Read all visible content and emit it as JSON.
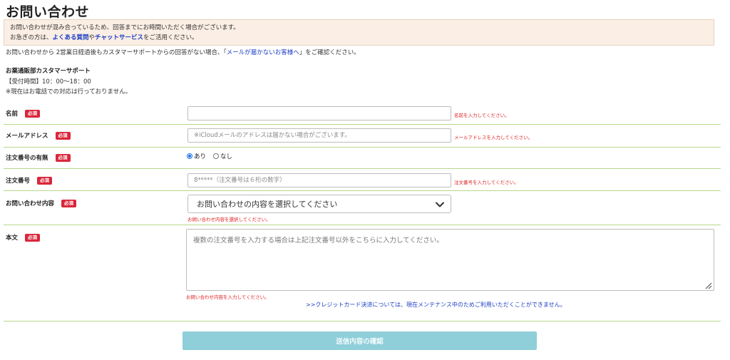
{
  "page": {
    "title": "お問い合わせ"
  },
  "notice": {
    "line1": "お問い合わせが混み合っているため、回答までにお時間いただく場合がございます。",
    "line2_prefix": "お急ぎの方は、",
    "faq_link": "よくある質問",
    "line2_mid": "や",
    "chat_link": "チャットサービス",
    "line2_suffix": "をご活用ください。"
  },
  "sub_note": {
    "prefix": "お問い合わせから 2営業日経過後もカスタマーサポートからの回答がない場合、「",
    "link": "メールが届かないお客様へ",
    "suffix": "」をご確認ください。"
  },
  "support": {
    "name": "お薬通販部カスタマーサポート",
    "hours": "【受付時間】10：00〜18：00",
    "phone_note": "※現在はお電話での対応は行っておりません。"
  },
  "required_badge": "必須",
  "form": {
    "name": {
      "label": "名前",
      "value": "",
      "placeholder": "",
      "error": "名前を入力してください。"
    },
    "email": {
      "label": "メールアドレス",
      "value": "",
      "placeholder": "※iCloudメールのアドレスは届かない場合がございます。",
      "error": "メールアドレスを入力してください。"
    },
    "order_presence": {
      "label": "注文番号の有無",
      "options": [
        "あり",
        "なし"
      ],
      "selected": "あり"
    },
    "order_number": {
      "label": "注文番号",
      "value": "",
      "placeholder": "8*****（注文番号は６桁の数字）",
      "error": "注文番号を入力してください。"
    },
    "inquiry_type": {
      "label": "お問い合わせ内容",
      "selected": "お問い合わせの内容を選択してください",
      "error": "お問い合わせ内容を選択してください。"
    },
    "body": {
      "label": "本文",
      "value": "",
      "placeholder": "複数の注文番号を入力する場合は上記注文番号以外をこちらに入力してください。",
      "error": "お問い合わせ内容を入力してください。"
    }
  },
  "maintenance_link": ">>クレジットカード決済については、現在メンテナンス中のためご利用いただくことができません。",
  "submit_label": "送信内容の確認",
  "colors": {
    "accent_line": "#b9d88c",
    "error": "#e02020",
    "link": "#1a3ec4",
    "button": "#8fcfd9",
    "notice_bg": "#fbeee4"
  }
}
